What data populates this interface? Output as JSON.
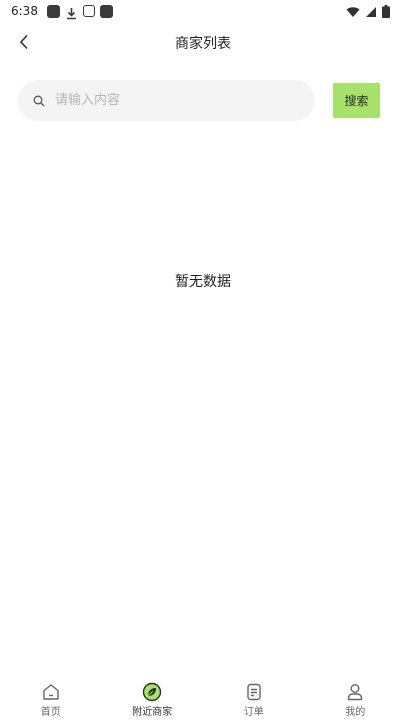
{
  "status_bar": {
    "time": "6:38"
  },
  "header": {
    "title": "商家列表"
  },
  "search": {
    "placeholder": "请输入内容",
    "value": "",
    "button_label": "搜索"
  },
  "empty_state": {
    "text": "暂无数据"
  },
  "colors": {
    "accent": "#a7e06a",
    "search_bg": "#f4f4f4"
  },
  "tabbar": {
    "items": [
      {
        "label": "首页",
        "icon": "home-icon",
        "active": false
      },
      {
        "label": "附近商家",
        "icon": "leaf-icon",
        "active": true
      },
      {
        "label": "订单",
        "icon": "order-icon",
        "active": false
      },
      {
        "label": "我的",
        "icon": "user-icon",
        "active": false
      }
    ]
  }
}
